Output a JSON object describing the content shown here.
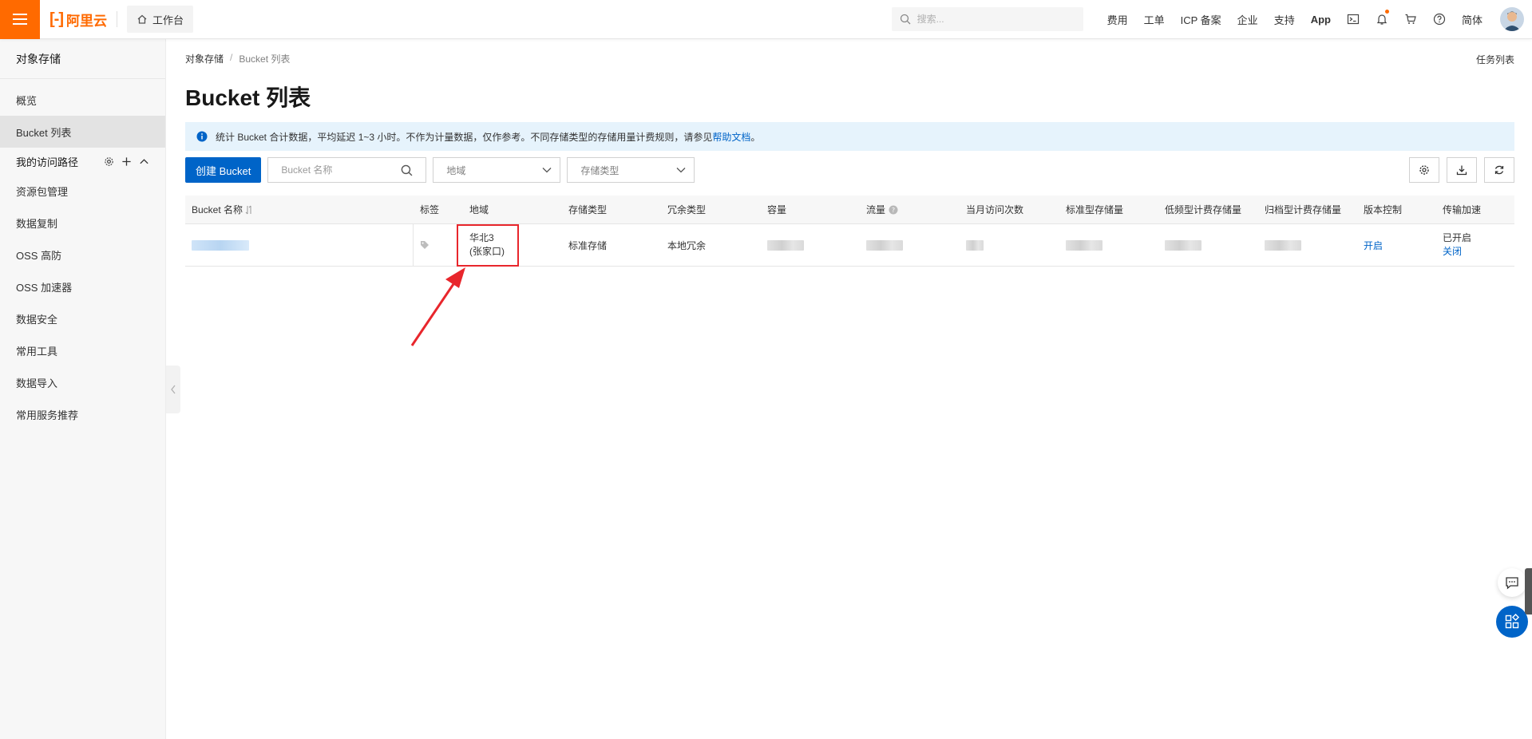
{
  "header": {
    "logo_text": "阿里云",
    "workbench_label": "工作台",
    "search_placeholder": "搜索...",
    "nav": [
      "费用",
      "工单",
      "ICP 备案",
      "企业",
      "支持",
      "App"
    ],
    "language": "简体",
    "accent_color": "#ff6a00"
  },
  "sidebar": {
    "title": "对象存储",
    "items": [
      {
        "label": "概览"
      },
      {
        "label": "Bucket 列表",
        "active": true
      }
    ],
    "group_label": "我的访问路径",
    "items2": [
      {
        "label": "资源包管理"
      },
      {
        "label": "数据复制"
      },
      {
        "label": "OSS 高防"
      },
      {
        "label": "OSS 加速器"
      },
      {
        "label": "数据安全"
      },
      {
        "label": "常用工具"
      },
      {
        "label": "数据导入"
      },
      {
        "label": "常用服务推荐"
      }
    ]
  },
  "main": {
    "breadcrumb": [
      "对象存储",
      "Bucket 列表"
    ],
    "task_list": "任务列表",
    "title": "Bucket 列表",
    "notice": {
      "text": "统计 Bucket 合计数据，平均延迟 1~3 小时。不作为计量数据，仅作参考。不同存储类型的存储用量计费规则，请参见",
      "link": "帮助文档",
      "end": "。"
    },
    "toolbar": {
      "create_label": "创建 Bucket",
      "name_placeholder": "Bucket 名称",
      "region_placeholder": "地域",
      "storage_placeholder": "存储类型"
    },
    "table": {
      "headers": [
        "Bucket 名称",
        "标签",
        "地域",
        "存储类型",
        "冗余类型",
        "容量",
        "流量",
        "当月访问次数",
        "标准型存储量",
        "低频型计费存储量",
        "归档型计费存储量",
        "版本控制",
        "传输加速"
      ],
      "row": {
        "region_line1": "华北3",
        "region_line2": "(张家口)",
        "storage_type": "标准存储",
        "redundancy": "本地冗余",
        "versioning": "开启",
        "acceleration_status": "已开启",
        "acceleration_action": "关闭"
      }
    },
    "primary_color": "#0064c8",
    "highlight_color": "#e8262c"
  }
}
